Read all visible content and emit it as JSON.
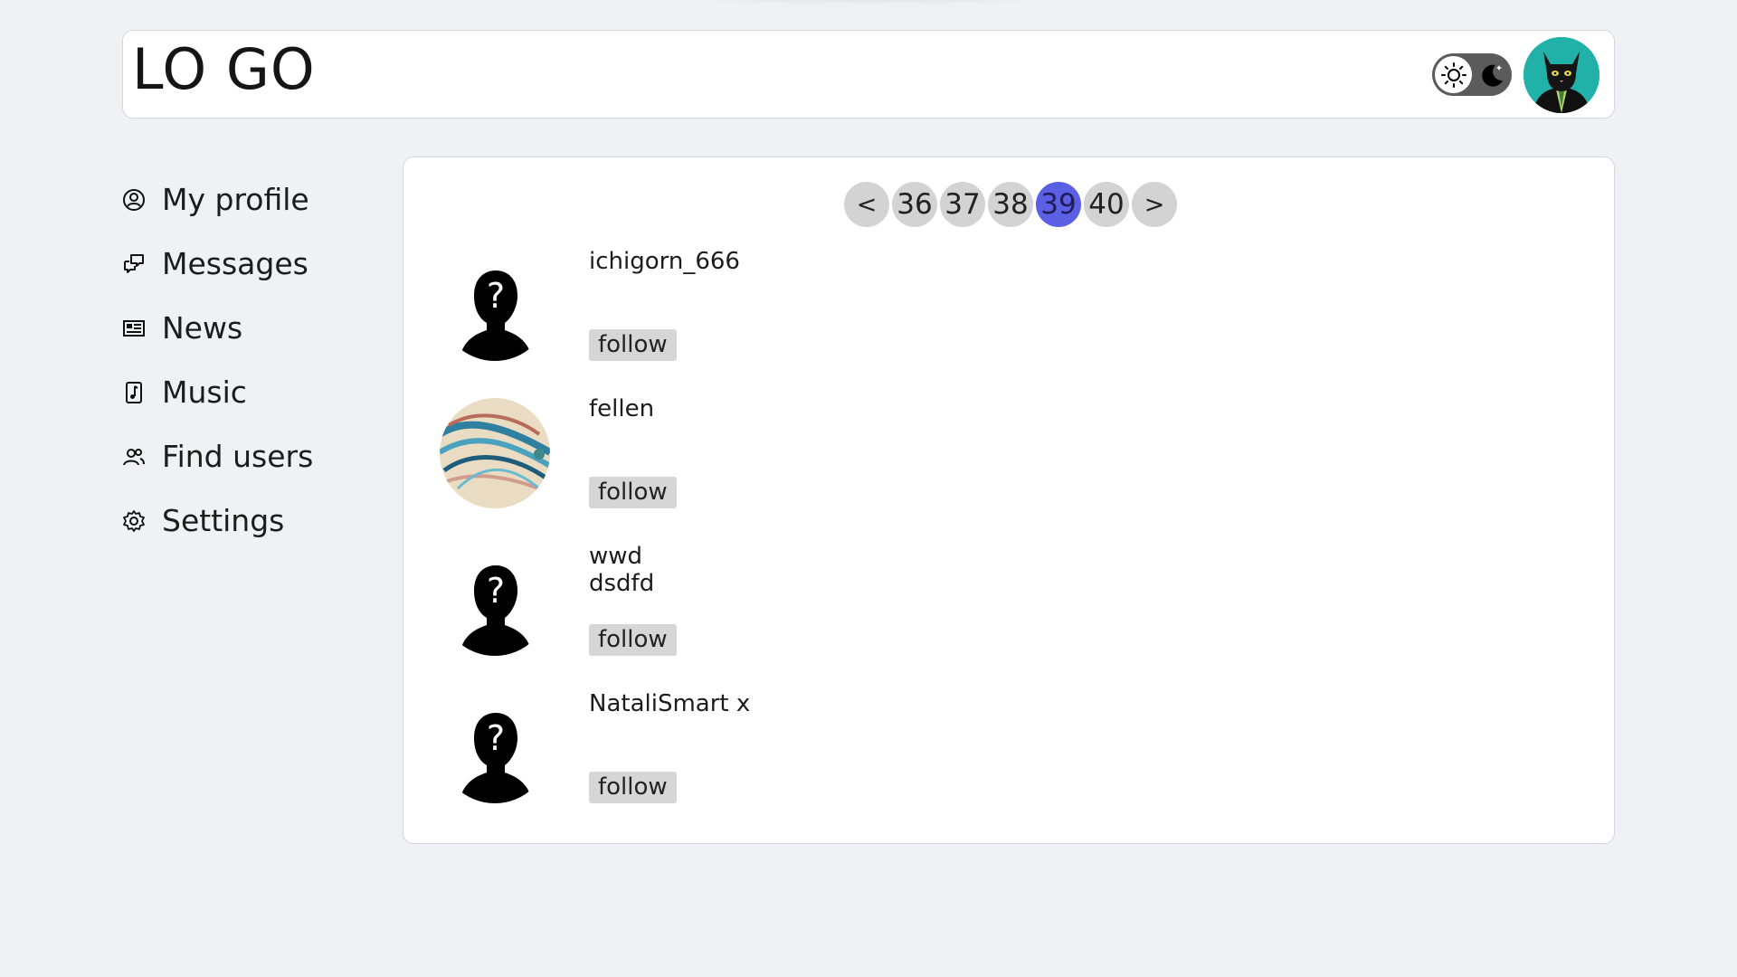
{
  "header": {
    "logo": "LO GO",
    "theme_toggle_icons": [
      "sun-icon",
      "moon-icon"
    ],
    "avatar_icon": "cat-avatar"
  },
  "sidebar": {
    "items": [
      {
        "label": "My profile",
        "icon": "user-circle-icon"
      },
      {
        "label": "Messages",
        "icon": "chat-icon"
      },
      {
        "label": "News",
        "icon": "newspaper-icon"
      },
      {
        "label": "Music",
        "icon": "music-file-icon"
      },
      {
        "label": "Find users",
        "icon": "users-icon"
      },
      {
        "label": "Settings",
        "icon": "gear-icon"
      }
    ]
  },
  "pagination": {
    "prev": "<",
    "pages": [
      "36",
      "37",
      "38",
      "39",
      "40"
    ],
    "current": "39",
    "next": ">"
  },
  "users": [
    {
      "name": "ichigorn_666",
      "avatar": "silhouette-placeholder",
      "follow_label": "follow"
    },
    {
      "name": "fellen",
      "avatar": "artwork-photo",
      "follow_label": "follow"
    },
    {
      "name": "wwd dsdfd",
      "avatar": "silhouette-placeholder",
      "follow_label": "follow"
    },
    {
      "name": "NataliSmart x",
      "avatar": "silhouette-placeholder",
      "follow_label": "follow"
    }
  ],
  "colors": {
    "background": "#f0f1f5",
    "active_page": "#5b5fe3",
    "page_button": "#d3d3d3",
    "follow_button": "#d6d6d6"
  }
}
